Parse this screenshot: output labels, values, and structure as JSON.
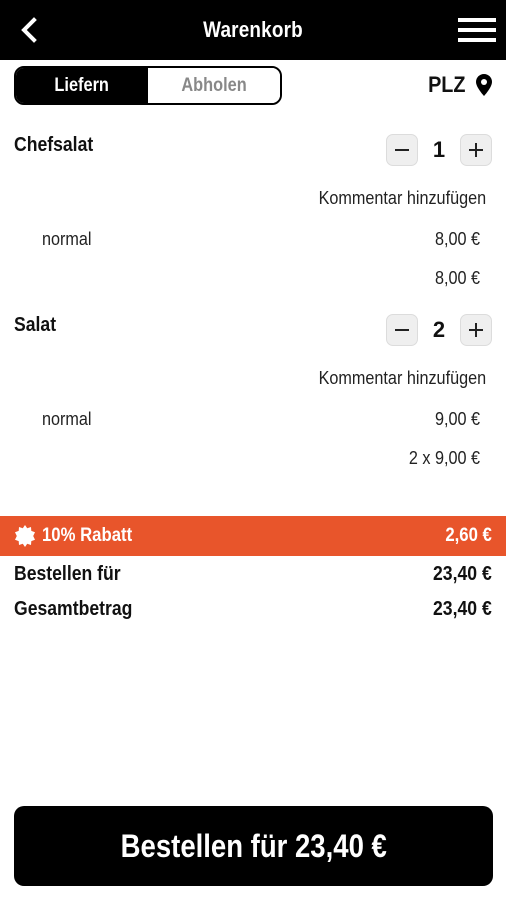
{
  "header": {
    "title": "Warenkorb"
  },
  "segment": {
    "deliver_label": "Liefern",
    "pickup_label": "Abholen",
    "active": "Liefern"
  },
  "location": {
    "label": "PLZ"
  },
  "items": [
    {
      "name": "Chefsalat",
      "quantity": "1",
      "comment_label": "Kommentar hinzufügen",
      "variant": "normal",
      "unit_price": "8,00 €",
      "line_total": "8,00 €"
    },
    {
      "name": "Salat",
      "quantity": "2",
      "comment_label": "Kommentar hinzufügen",
      "variant": "normal",
      "unit_price": "9,00 €",
      "line_total": "2 x 9,00 €"
    }
  ],
  "discount": {
    "label": "10% Rabatt",
    "amount": "2,60 €",
    "color": "#e8552b"
  },
  "summary": {
    "order_label": "Bestellen für",
    "order_amount": "23,40 €",
    "total_label": "Gesamtbetrag",
    "total_amount": "23,40 €"
  },
  "cta": {
    "label": "Bestellen für 23,40 €"
  }
}
